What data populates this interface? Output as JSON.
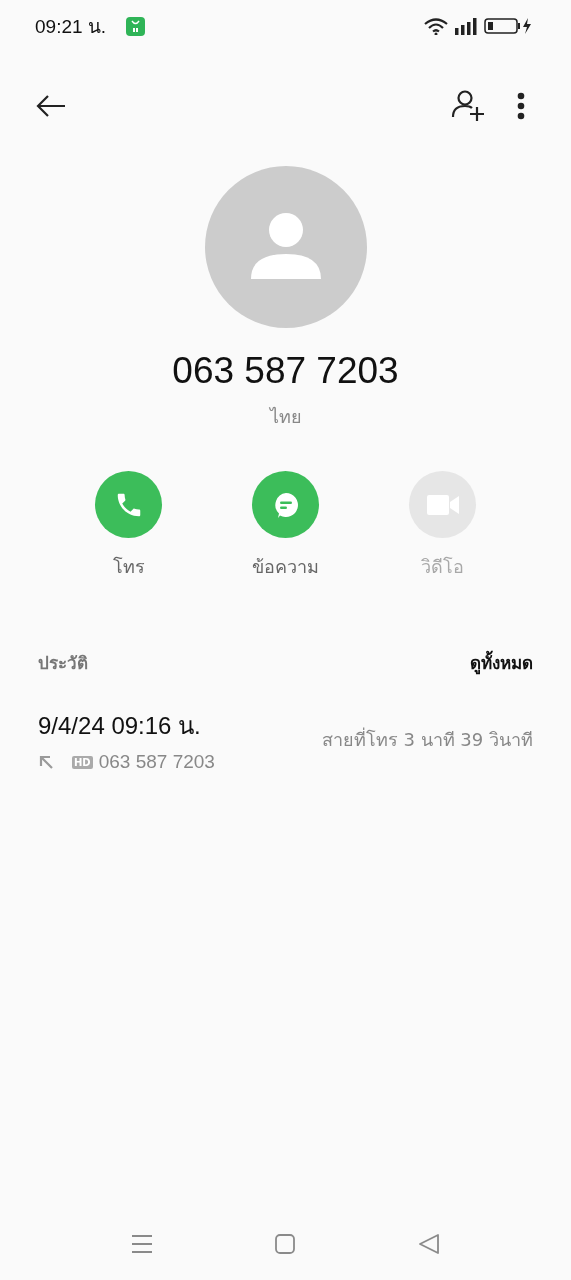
{
  "status_bar": {
    "time": "09:21 น."
  },
  "contact": {
    "number": "063 587 7203",
    "region": "ไทย"
  },
  "actions": [
    {
      "kind": "call",
      "label": "โทร",
      "disabled": false
    },
    {
      "kind": "message",
      "label": "ข้อความ",
      "disabled": false
    },
    {
      "kind": "video",
      "label": "วิดีโอ",
      "disabled": true
    }
  ],
  "history": {
    "title": "ประวัติ",
    "see_all": "ดูทั้งหมด",
    "entries": [
      {
        "datetime": "9/4/24 09:16 น.",
        "badge": "HD",
        "number": "063 587 7203",
        "summary": "สายที่โทร  3 นาที 39 วินาที"
      }
    ]
  }
}
